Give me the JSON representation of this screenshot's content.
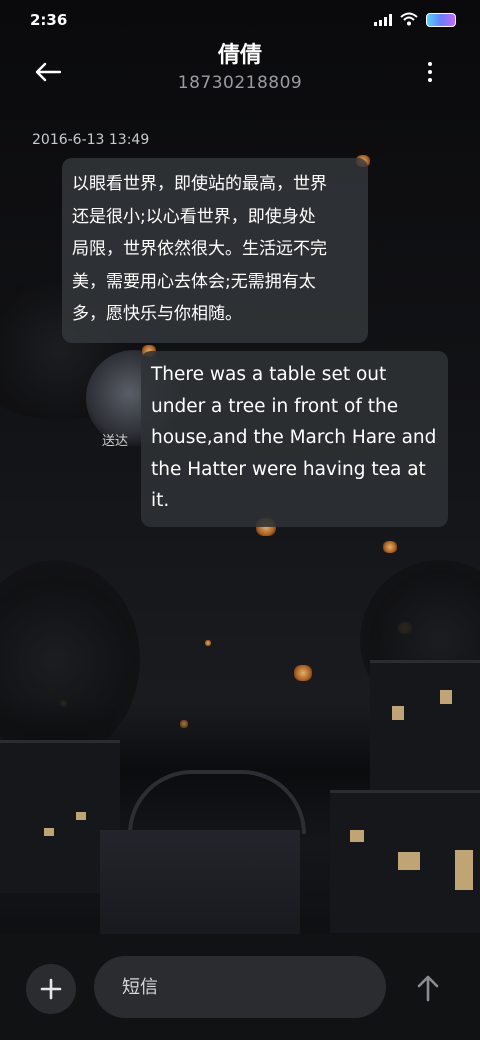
{
  "status_bar": {
    "time": "2:36",
    "icons": [
      "signal-icon",
      "wifi-icon",
      "battery-icon"
    ]
  },
  "header": {
    "back_icon": "arrow-left-icon",
    "contact_name": "倩倩",
    "contact_number": "18730218809",
    "more_icon": "more-vertical-icon"
  },
  "conversation": {
    "timestamp": "2016-6-13 13:49",
    "messages": [
      {
        "direction": "incoming",
        "lines": [
          "以眼看世界，即使站的最高，世界",
          "还是很小;以心看世界，即使身处",
          "局限，世界依然很大。生活远不完",
          "美，需要用心去体会;无需拥有太",
          "多，愿快乐与你相随。"
        ]
      },
      {
        "direction": "outgoing",
        "lines": [
          "There was a table set out",
          "under a tree in front of the",
          "house,and the March Hare and",
          "the Hatter were having tea at",
          "it."
        ],
        "status": "送达"
      }
    ]
  },
  "input_bar": {
    "attach_icon": "plus-icon",
    "placeholder": "短信",
    "send_icon": "arrow-up-icon"
  },
  "colors": {
    "bubble": "#34383c",
    "background": "#0d0d0f",
    "battery_gradient": [
      "#4fd4ff",
      "#6a7dff",
      "#c36bff"
    ]
  }
}
